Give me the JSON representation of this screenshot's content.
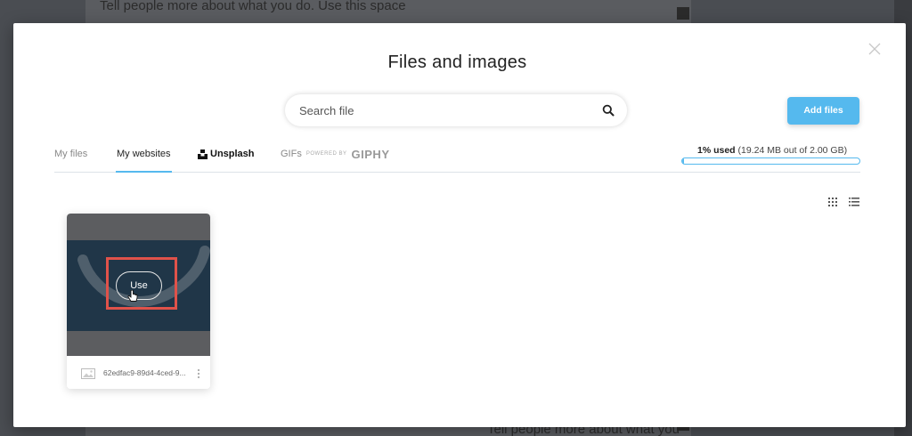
{
  "background": {
    "top_text": "Tell people more about what you do. Use this space",
    "bottom_text": "Tell people more about what you"
  },
  "modal": {
    "title": "Files and images",
    "search": {
      "placeholder": "Search file",
      "value": ""
    },
    "add_files_label": "Add files",
    "tabs": [
      {
        "label": "My files",
        "active": false
      },
      {
        "label": "My websites",
        "active": true
      },
      {
        "label": "Unsplash",
        "active": false
      },
      {
        "label": "GIFs",
        "active": false
      }
    ],
    "giphy": {
      "powered_by": "POWERED BY",
      "brand": "GIPHY"
    },
    "storage": {
      "used_percent_label": "1% used",
      "detail": "(19.24 MB out of 2.00 GB)",
      "fraction_used": 0.01
    },
    "files": [
      {
        "name": "62edfac9-89d4-4ced-9...",
        "hover_action": "Use"
      }
    ]
  },
  "colors": {
    "accent": "#55b9ee",
    "highlight": "#e0524a",
    "thumb_bg": "#203648"
  },
  "icons": [
    "close-icon",
    "search-icon",
    "unsplash-logo-icon",
    "grid-view-icon",
    "list-view-icon",
    "image-file-icon",
    "more-vertical-icon",
    "hand-cursor-icon"
  ]
}
